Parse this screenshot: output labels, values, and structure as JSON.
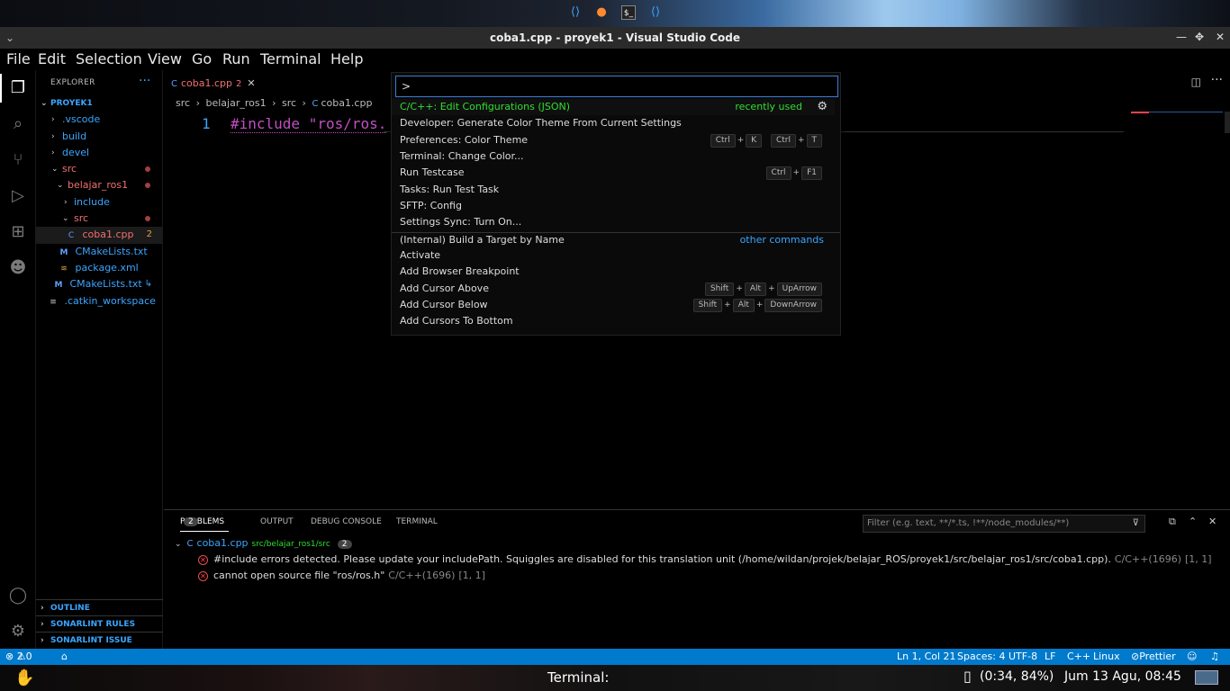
{
  "window": {
    "title": "coba1.cpp - proyek1 - Visual Studio Code"
  },
  "menu": [
    "File",
    "Edit",
    "Selection",
    "View",
    "Go",
    "Run",
    "Terminal",
    "Help"
  ],
  "explorer": {
    "title": "EXPLORER",
    "more": "···",
    "root": "PROYEK1",
    "items": [
      {
        "label": ".vscode"
      },
      {
        "label": "build"
      },
      {
        "label": "devel"
      },
      {
        "label": "src"
      },
      {
        "label": "belajar_ros1"
      },
      {
        "label": "include"
      },
      {
        "label": "src"
      },
      {
        "label": "coba1.cpp",
        "count": "2"
      },
      {
        "label": "CMakeLists.txt"
      },
      {
        "label": "package.xml"
      },
      {
        "label": "CMakeLists.txt"
      },
      {
        "label": ".catkin_workspace"
      }
    ],
    "sections": [
      "OUTLINE",
      "SONARLINT RULES",
      "SONARLINT ISSUE LOCAT..."
    ]
  },
  "editor": {
    "tab": {
      "label": "coba1.cpp",
      "badge": "2"
    },
    "breadcrumbs": [
      "src",
      "belajar_ros1",
      "src",
      "coba1.cpp"
    ],
    "line_number": "1",
    "code": "#include \"ros/ros."
  },
  "palette": {
    "input": ">",
    "recently_used": [
      {
        "label": "C/C++: Edit Configurations (JSON)",
        "tag": "recently used"
      },
      {
        "label": "Developer: Generate Color Theme From Current Settings"
      },
      {
        "label": "Preferences: Color Theme",
        "keys": [
          [
            "Ctrl",
            "K"
          ],
          [
            "Ctrl",
            "T"
          ]
        ]
      },
      {
        "label": "Terminal: Change Color..."
      },
      {
        "label": "Run Testcase",
        "keys": [
          [
            "Ctrl",
            "F1"
          ]
        ]
      },
      {
        "label": "Tasks: Run Test Task"
      },
      {
        "label": "SFTP: Config"
      },
      {
        "label": "Settings Sync: Turn On..."
      }
    ],
    "other": [
      {
        "label": "(Internal) Build a Target by Name",
        "tag": "other commands"
      },
      {
        "label": "Activate"
      },
      {
        "label": "Add Browser Breakpoint"
      },
      {
        "label": "Add Cursor Above",
        "keys": [
          [
            "Shift",
            "Alt",
            "UpArrow"
          ]
        ]
      },
      {
        "label": "Add Cursor Below",
        "keys": [
          [
            "Shift",
            "Alt",
            "DownArrow"
          ]
        ]
      },
      {
        "label": "Add Cursors To Bottom"
      }
    ]
  },
  "panel": {
    "tabs": [
      "PROBLEMS",
      "OUTPUT",
      "DEBUG CONSOLE",
      "TERMINAL"
    ],
    "problems_count": "2",
    "filter_placeholder": "Filter (e.g. text, **/*.ts, !**/node_modules/**)",
    "file": {
      "name": "coba1.cpp",
      "path": "src/belajar_ros1/src",
      "count": "2"
    },
    "errors": [
      {
        "message": "#include errors detected. Please update your includePath. Squiggles are disabled for this translation unit (/home/wildan/projek/belajar_ROS/proyek1/src/belajar_ros1/src/coba1.cpp).",
        "source": "C/C++(1696)",
        "pos": "[1, 1]"
      },
      {
        "message": "cannot open source file \"ros/ros.h\"",
        "source": "C/C++(1696)",
        "pos": "[1, 1]"
      }
    ]
  },
  "status": {
    "errors": "2",
    "warnings": "0",
    "position": "Ln 1, Col 21",
    "spaces": "Spaces: 4",
    "encoding": "UTF-8",
    "eol": "LF",
    "language": "C++",
    "platform": "Linux",
    "formatter": "Prettier"
  },
  "taskbar": {
    "app": "Terminal:",
    "battery": "(0:34, 84%)",
    "clock": "Jum 13 Agu, 08:45"
  }
}
